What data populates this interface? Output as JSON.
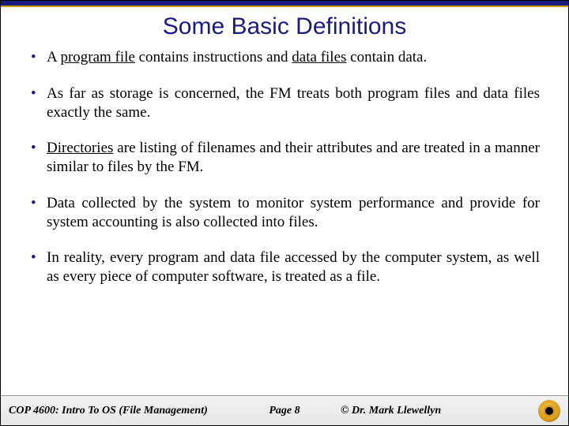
{
  "title": "Some Basic Definitions",
  "bullets": {
    "b1_pre": "A ",
    "b1_u1": "program file",
    "b1_mid": " contains instructions and ",
    "b1_u2": "data files",
    "b1_post": " contain data.",
    "b2": "As far as storage is concerned, the FM treats both program files and data files exactly the same.",
    "b3_u": "Directories",
    "b3_post": " are listing of filenames and their attributes and are treated in a manner similar to files by the FM.",
    "b4": "Data collected by the system to monitor system performance and provide for system accounting is also collected into files.",
    "b5": "In reality, every program and data file accessed by the computer system, as well as every piece of computer software, is treated as a file."
  },
  "footer": {
    "course": "COP 4600: Intro To OS  (File Management)",
    "page": "Page 8",
    "author": "© Dr. Mark Llewellyn"
  }
}
